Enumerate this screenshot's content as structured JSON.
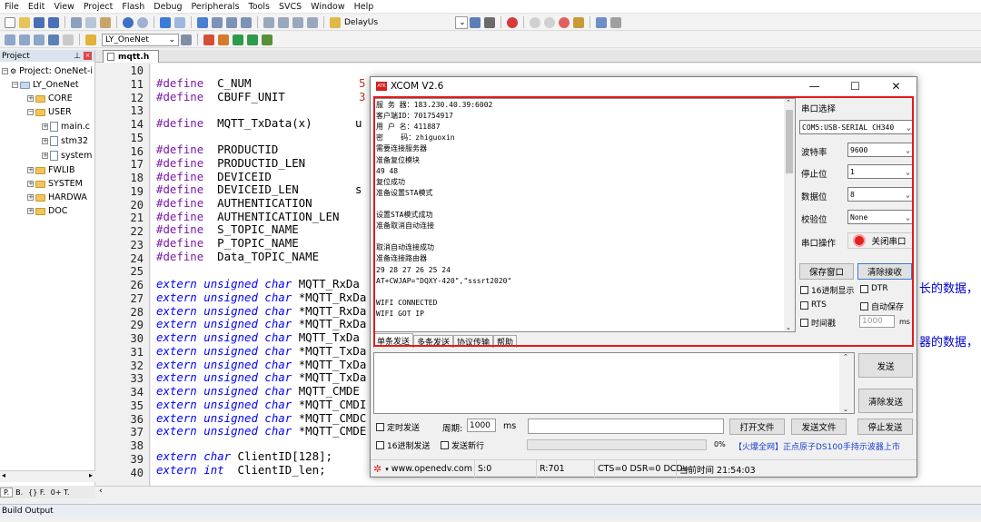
{
  "menu": [
    "File",
    "Edit",
    "View",
    "Project",
    "Flash",
    "Debug",
    "Peripherals",
    "Tools",
    "SVCS",
    "Window",
    "Help"
  ],
  "toolbar": {
    "delay_combo": "DelayUs",
    "target_combo": "LY_OneNet"
  },
  "project": {
    "header": "Project",
    "root": "Project: OneNet-i",
    "target": "LY_OneNet",
    "groups": [
      "CORE",
      "USER",
      "main.c",
      "stm32",
      "system",
      "FWLIB",
      "SYSTEM",
      "HARDWA",
      "DOC"
    ],
    "bottom_tabs": [
      "P.",
      "B.",
      "{} F.",
      "0+ T."
    ]
  },
  "editor": {
    "tab": "mqtt.h",
    "line_numbers": [
      "10",
      "11",
      "12",
      "13",
      "14",
      "15",
      "16",
      "17",
      "18",
      "19",
      "20",
      "21",
      "22",
      "23",
      "24",
      "25",
      "26",
      "27",
      "28",
      "29",
      "30",
      "31",
      "32",
      "33",
      "34",
      "35",
      "36",
      "37",
      "38",
      "39",
      "40"
    ],
    "defines": {
      "d11": "C_NUM",
      "d12": "CBUFF_UNIT",
      "d14": "MQTT_TxData(x)",
      "d16": "PRODUCTID",
      "d17": "PRODUCTID_LEN",
      "d18": "DEVICEID",
      "d19": "DEVICEID_LEN",
      "d20": "AUTHENTICATION",
      "d21": "AUTHENTICATION_LEN",
      "d22": "S_TOPIC_NAME",
      "d23": "P_TOPIC_NAME",
      "d24": "Data_TOPIC_NAME"
    },
    "define_kw": "#define",
    "extern_kw": "extern",
    "unsigned_kw": "unsigned",
    "char_kw": "char",
    "int_kw": "int",
    "externs": [
      "MQTT_RxDa",
      "*MQTT_RxDa",
      "*MQTT_RxDa",
      "*MQTT_RxDa",
      "MQTT_TxDa",
      "*MQTT_TxDa",
      "*MQTT_TxDa",
      "*MQTT_TxDa",
      "MQTT_CMDE",
      "*MQTT_CMDI",
      "*MQTT_CMDC",
      "*MQTT_CMDE"
    ],
    "line39": "ClientID[128];",
    "line40": "ClientID_len;",
    "right_text_1": "长的数据，",
    "right_text_2": "器的数据，",
    "frag_c_num": "5",
    "frag_cbuff": "3",
    "frag_u": "u",
    "frag_s": "s"
  },
  "xcom": {
    "title": "XCOM V2.6",
    "logo": "ATK",
    "recv_lines": [
      "服 务 器：183.230.40.39:6002",
      "客户端ID：701754917",
      "用 户 名：411887",
      "密    码：zhiguoxin",
      "需要连接服务器",
      "准备复位模块",
      "49 48",
      "复位成功",
      "准备设置STA模式",
      "",
      "设置STA模式成功",
      "准备取消自动连接",
      "",
      "取消自动连接成功",
      "准备连接路由器",
      "29 28 27 26 25 24",
      "AT+CWJAP=\"DQXY-420\",\"sssrt2020\"",
      "",
      "WIFI CONNECTED",
      "WIFI GOT IP"
    ],
    "tabs": [
      "单条发送",
      "多条发送",
      "协议传输",
      "帮助"
    ],
    "port_label": "串口选择",
    "port_value": "COM5:USB-SERIAL CH340",
    "baud_label": "波特率",
    "baud_value": "9600",
    "stop_label": "停止位",
    "stop_value": "1",
    "data_label": "数据位",
    "data_value": "8",
    "parity_label": "校验位",
    "parity_value": "None",
    "op_label": "串口操作",
    "close_port": "关闭串口",
    "save_window": "保存窗口",
    "clear_recv": "清除接收",
    "hex_display": "16进制显示",
    "dtr": "DTR",
    "rts": "RTS",
    "auto_save": "自动保存",
    "timestamp": "时间戳",
    "timestamp_value": "1000",
    "ms": "ms",
    "send_btn": "发送",
    "clear_send": "清除发送",
    "timed_send": "定时发送",
    "period_label": "周期:",
    "period_value": "1000",
    "period_unit": "ms",
    "open_file": "打开文件",
    "send_file": "发送文件",
    "stop_send": "停止发送",
    "hex_send": "16进制发送",
    "send_newline": "发送新行",
    "progress": "0%",
    "ad_text": "【火爆全网】正点原子DS100手持示波器上市",
    "status_site": "www.openedv.com",
    "status_s": "S:0",
    "status_r": "R:701",
    "status_cts": "CTS=0 DSR=0 DCD=",
    "status_time": "当前时间 21:54:03"
  },
  "build_output": "Build Output",
  "colors": {
    "accent_red": "#e31b1b",
    "keyword": "#0000ff",
    "preproc": "#7a1aa8"
  }
}
